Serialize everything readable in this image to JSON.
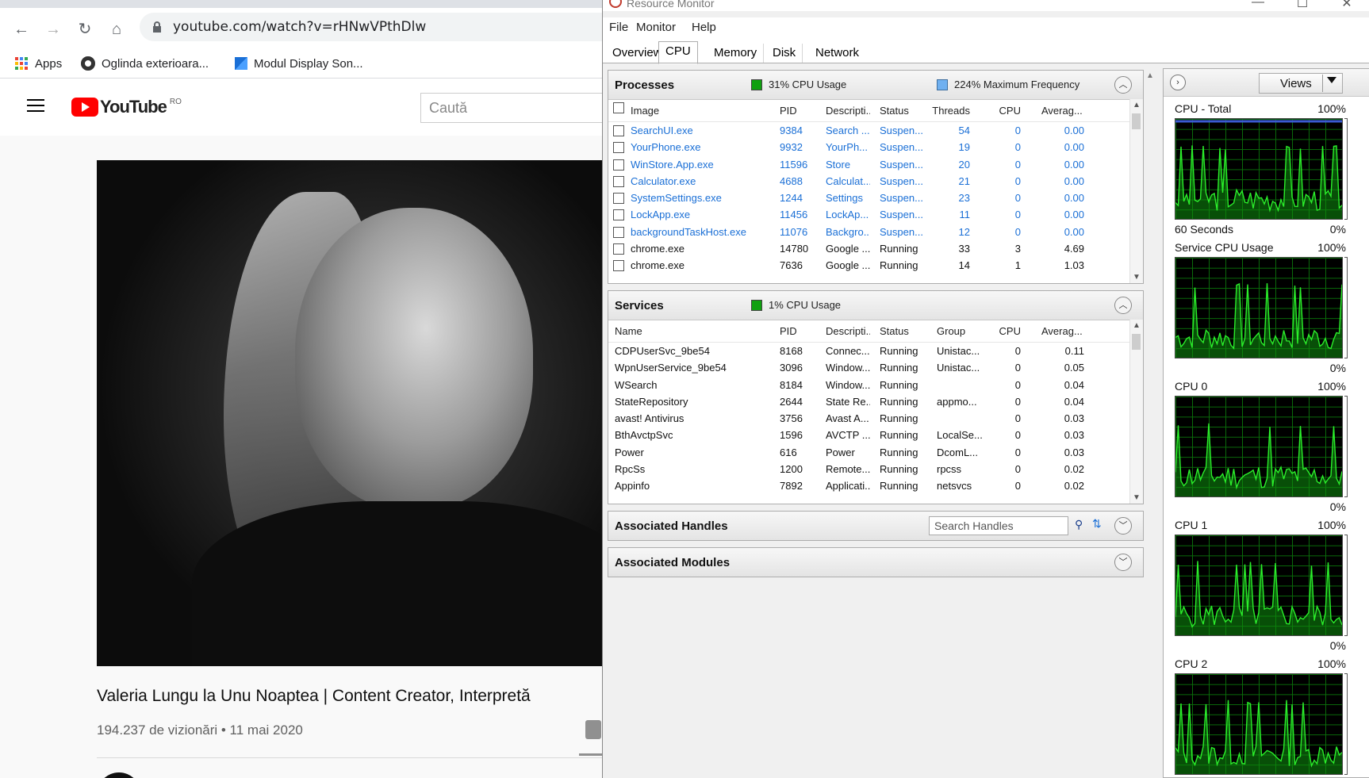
{
  "browser": {
    "url": "youtube.com/watch?v=rHNwVPthDlw",
    "bookmarks": [
      {
        "label": "Apps",
        "icon": "apps-grid-icon"
      },
      {
        "label": "Oglinda exterioara...",
        "icon": "site-favicon-icon"
      },
      {
        "label": "Modul Display Son...",
        "icon": "site-favicon-icon"
      }
    ]
  },
  "youtube": {
    "logo_text": "YouTube",
    "region": "RO",
    "search_placeholder": "Caută",
    "video_title": "Valeria Lungu la Unu Noaptea | Content Creator, Interpretă",
    "video_meta": "194.237 de vizionări • 11 mai 2020"
  },
  "resmon": {
    "title": "Resource Monitor",
    "menu": [
      "File",
      "Monitor",
      "Help"
    ],
    "tabs": [
      "Overview",
      "CPU",
      "Memory",
      "Disk",
      "Network"
    ],
    "active_tab": "CPU",
    "processes": {
      "title": "Processes",
      "cpu_usage": "31% CPU Usage",
      "max_freq": "224% Maximum Frequency",
      "columns": [
        "Image",
        "PID",
        "Descripti...",
        "Status",
        "Threads",
        "CPU",
        "Averag..."
      ],
      "rows": [
        {
          "image": "SearchUI.exe",
          "pid": "9384",
          "desc": "Search ...",
          "status": "Suspen...",
          "threads": "54",
          "cpu": "0",
          "avg": "0.00",
          "suspended": true
        },
        {
          "image": "YourPhone.exe",
          "pid": "9932",
          "desc": "YourPh...",
          "status": "Suspen...",
          "threads": "19",
          "cpu": "0",
          "avg": "0.00",
          "suspended": true
        },
        {
          "image": "WinStore.App.exe",
          "pid": "11596",
          "desc": "Store",
          "status": "Suspen...",
          "threads": "20",
          "cpu": "0",
          "avg": "0.00",
          "suspended": true
        },
        {
          "image": "Calculator.exe",
          "pid": "4688",
          "desc": "Calculat...",
          "status": "Suspen...",
          "threads": "21",
          "cpu": "0",
          "avg": "0.00",
          "suspended": true
        },
        {
          "image": "SystemSettings.exe",
          "pid": "1244",
          "desc": "Settings",
          "status": "Suspen...",
          "threads": "23",
          "cpu": "0",
          "avg": "0.00",
          "suspended": true
        },
        {
          "image": "LockApp.exe",
          "pid": "11456",
          "desc": "LockAp...",
          "status": "Suspen...",
          "threads": "11",
          "cpu": "0",
          "avg": "0.00",
          "suspended": true
        },
        {
          "image": "backgroundTaskHost.exe",
          "pid": "11076",
          "desc": "Backgro...",
          "status": "Suspen...",
          "threads": "12",
          "cpu": "0",
          "avg": "0.00",
          "suspended": true
        },
        {
          "image": "chrome.exe",
          "pid": "14780",
          "desc": "Google ...",
          "status": "Running",
          "threads": "33",
          "cpu": "3",
          "avg": "4.69",
          "suspended": false
        },
        {
          "image": "chrome.exe",
          "pid": "7636",
          "desc": "Google ...",
          "status": "Running",
          "threads": "14",
          "cpu": "1",
          "avg": "1.03",
          "suspended": false
        }
      ]
    },
    "services": {
      "title": "Services",
      "cpu_usage": "1% CPU Usage",
      "columns": [
        "Name",
        "PID",
        "Descripti...",
        "Status",
        "Group",
        "CPU",
        "Averag..."
      ],
      "rows": [
        {
          "name": "CDPUserSvc_9be54",
          "pid": "8168",
          "desc": "Connec...",
          "status": "Running",
          "group": "Unistac...",
          "cpu": "0",
          "avg": "0.11"
        },
        {
          "name": "WpnUserService_9be54",
          "pid": "3096",
          "desc": "Window...",
          "status": "Running",
          "group": "Unistac...",
          "cpu": "0",
          "avg": "0.05"
        },
        {
          "name": "WSearch",
          "pid": "8184",
          "desc": "Window...",
          "status": "Running",
          "group": "",
          "cpu": "0",
          "avg": "0.04"
        },
        {
          "name": "StateRepository",
          "pid": "2644",
          "desc": "State Re...",
          "status": "Running",
          "group": "appmo...",
          "cpu": "0",
          "avg": "0.04"
        },
        {
          "name": "avast! Antivirus",
          "pid": "3756",
          "desc": "Avast A...",
          "status": "Running",
          "group": "",
          "cpu": "0",
          "avg": "0.03"
        },
        {
          "name": "BthAvctpSvc",
          "pid": "1596",
          "desc": "AVCTP ...",
          "status": "Running",
          "group": "LocalSe...",
          "cpu": "0",
          "avg": "0.03"
        },
        {
          "name": "Power",
          "pid": "616",
          "desc": "Power",
          "status": "Running",
          "group": "DcomL...",
          "cpu": "0",
          "avg": "0.03"
        },
        {
          "name": "RpcSs",
          "pid": "1200",
          "desc": "Remote...",
          "status": "Running",
          "group": "rpcss",
          "cpu": "0",
          "avg": "0.02"
        },
        {
          "name": "Appinfo",
          "pid": "7892",
          "desc": "Applicati...",
          "status": "Running",
          "group": "netsvcs",
          "cpu": "0",
          "avg": "0.02"
        }
      ]
    },
    "handles": {
      "title": "Associated Handles",
      "search_placeholder": "Search Handles"
    },
    "modules": {
      "title": "Associated Modules"
    },
    "graphs": {
      "views_label": "Views",
      "items": [
        {
          "label": "CPU - Total",
          "max": "100%",
          "foot_left": "60 Seconds",
          "foot_right": "0%"
        },
        {
          "label": "Service CPU Usage",
          "max": "100%",
          "foot_left": "",
          "foot_right": "0%"
        },
        {
          "label": "CPU 0",
          "max": "100%",
          "foot_left": "",
          "foot_right": "0%"
        },
        {
          "label": "CPU 1",
          "max": "100%",
          "foot_left": "",
          "foot_right": "0%"
        },
        {
          "label": "CPU 2",
          "max": "100%",
          "foot_left": "",
          "foot_right": ""
        }
      ]
    }
  },
  "colors": {
    "yt_red": "#ff0000",
    "graph_green": "#19c419",
    "link_blue": "#1a6fd6"
  }
}
